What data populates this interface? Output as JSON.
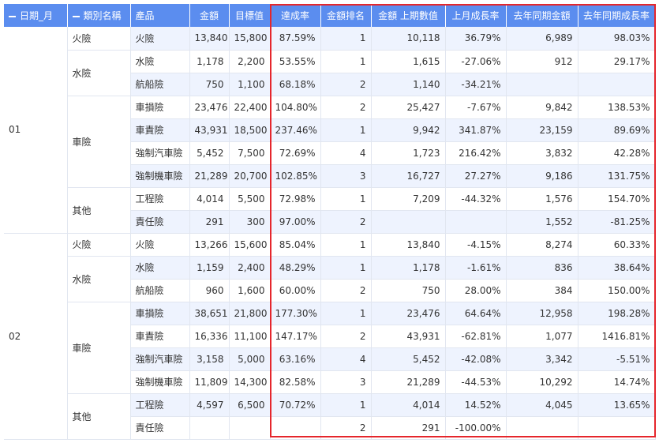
{
  "headers": {
    "date": "日期_月",
    "category": "類別名稱",
    "product": "產品",
    "amount": "金額",
    "target": "目標值",
    "rate": "達成率",
    "rank": "金額排名",
    "prev": "金額 上期數值",
    "mom": "上月成長率",
    "yoy_amount": "去年同期金額",
    "yoy": "去年同期成長率"
  },
  "months": [
    {
      "label": "01",
      "groups": [
        {
          "label": "火險",
          "rows": [
            {
              "product": "火險",
              "amount": "13,840",
              "target": "15,800",
              "rate": "87.59%",
              "rank": "1",
              "prev": "10,118",
              "mom": "36.79%",
              "yoy_amount": "6,989",
              "yoy": "98.03%"
            }
          ]
        },
        {
          "label": "水險",
          "rows": [
            {
              "product": "水險",
              "amount": "1,178",
              "target": "2,200",
              "rate": "53.55%",
              "rank": "1",
              "prev": "1,615",
              "mom": "-27.06%",
              "yoy_amount": "912",
              "yoy": "29.17%"
            },
            {
              "product": "航船險",
              "amount": "750",
              "target": "1,100",
              "rate": "68.18%",
              "rank": "2",
              "prev": "1,140",
              "mom": "-34.21%",
              "yoy_amount": "",
              "yoy": ""
            }
          ]
        },
        {
          "label": "車險",
          "rows": [
            {
              "product": "車損險",
              "amount": "23,476",
              "target": "22,400",
              "rate": "104.80%",
              "rank": "2",
              "prev": "25,427",
              "mom": "-7.67%",
              "yoy_amount": "9,842",
              "yoy": "138.53%"
            },
            {
              "product": "車責險",
              "amount": "43,931",
              "target": "18,500",
              "rate": "237.46%",
              "rank": "1",
              "prev": "9,942",
              "mom": "341.87%",
              "yoy_amount": "23,159",
              "yoy": "89.69%"
            },
            {
              "product": "強制汽車險",
              "amount": "5,452",
              "target": "7,500",
              "rate": "72.69%",
              "rank": "4",
              "prev": "1,723",
              "mom": "216.42%",
              "yoy_amount": "3,832",
              "yoy": "42.28%"
            },
            {
              "product": "強制機車險",
              "amount": "21,289",
              "target": "20,700",
              "rate": "102.85%",
              "rank": "3",
              "prev": "16,727",
              "mom": "27.27%",
              "yoy_amount": "9,186",
              "yoy": "131.75%"
            }
          ]
        },
        {
          "label": "其他",
          "rows": [
            {
              "product": "工程險",
              "amount": "4,014",
              "target": "5,500",
              "rate": "72.98%",
              "rank": "1",
              "prev": "7,209",
              "mom": "-44.32%",
              "yoy_amount": "1,576",
              "yoy": "154.70%"
            },
            {
              "product": "責任險",
              "amount": "291",
              "target": "300",
              "rate": "97.00%",
              "rank": "2",
              "prev": "",
              "mom": "",
              "yoy_amount": "1,552",
              "yoy": "-81.25%"
            }
          ]
        }
      ]
    },
    {
      "label": "02",
      "groups": [
        {
          "label": "火險",
          "rows": [
            {
              "product": "火險",
              "amount": "13,266",
              "target": "15,600",
              "rate": "85.04%",
              "rank": "1",
              "prev": "13,840",
              "mom": "-4.15%",
              "yoy_amount": "8,274",
              "yoy": "60.33%"
            }
          ]
        },
        {
          "label": "水險",
          "rows": [
            {
              "product": "水險",
              "amount": "1,159",
              "target": "2,400",
              "rate": "48.29%",
              "rank": "1",
              "prev": "1,178",
              "mom": "-1.61%",
              "yoy_amount": "836",
              "yoy": "38.64%"
            },
            {
              "product": "航船險",
              "amount": "960",
              "target": "1,600",
              "rate": "60.00%",
              "rank": "2",
              "prev": "750",
              "mom": "28.00%",
              "yoy_amount": "384",
              "yoy": "150.00%"
            }
          ]
        },
        {
          "label": "車險",
          "rows": [
            {
              "product": "車損險",
              "amount": "38,651",
              "target": "21,800",
              "rate": "177.30%",
              "rank": "1",
              "prev": "23,476",
              "mom": "64.64%",
              "yoy_amount": "12,958",
              "yoy": "198.28%"
            },
            {
              "product": "車責險",
              "amount": "16,336",
              "target": "11,100",
              "rate": "147.17%",
              "rank": "2",
              "prev": "43,931",
              "mom": "-62.81%",
              "yoy_amount": "1,077",
              "yoy": "1416.81%"
            },
            {
              "product": "強制汽車險",
              "amount": "3,158",
              "target": "5,000",
              "rate": "63.16%",
              "rank": "4",
              "prev": "5,452",
              "mom": "-42.08%",
              "yoy_amount": "3,342",
              "yoy": "-5.51%"
            },
            {
              "product": "強制機車險",
              "amount": "11,809",
              "target": "14,300",
              "rate": "82.58%",
              "rank": "3",
              "prev": "21,289",
              "mom": "-44.53%",
              "yoy_amount": "10,292",
              "yoy": "14.74%"
            }
          ]
        },
        {
          "label": "其他",
          "rows": [
            {
              "product": "工程險",
              "amount": "4,597",
              "target": "6,500",
              "rate": "70.72%",
              "rank": "1",
              "prev": "4,014",
              "mom": "14.52%",
              "yoy_amount": "4,045",
              "yoy": "13.65%"
            },
            {
              "product": "責任險",
              "amount": "",
              "target": "",
              "rate": "",
              "rank": "2",
              "prev": "291",
              "mom": "-100.00%",
              "yoy_amount": "",
              "yoy": ""
            }
          ]
        }
      ]
    }
  ],
  "colors": {
    "header_bg": "#5b8def",
    "stripe": "#eef3fe",
    "highlight_border": "#e5262c"
  }
}
